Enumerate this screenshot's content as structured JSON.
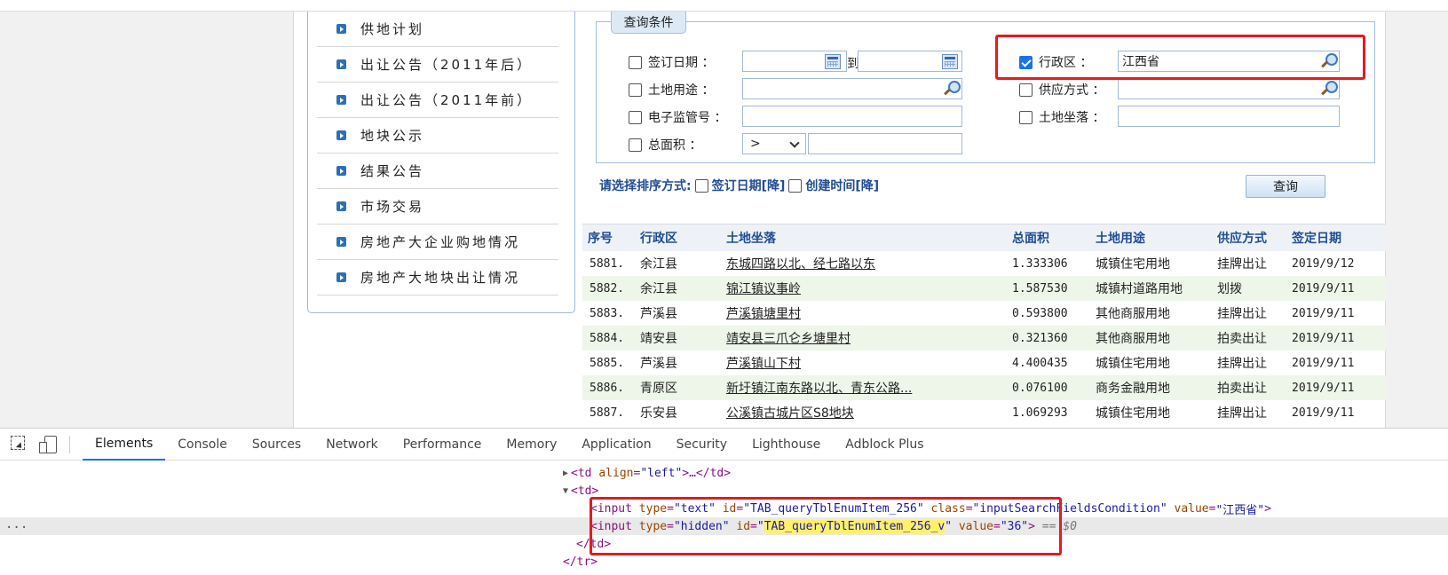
{
  "left_menu": {
    "items": [
      "供地计划",
      "出让公告（2011年后）",
      "出让公告（2011年前）",
      "地块公示",
      "结果公告",
      "市场交易",
      "房地产大企业购地情况",
      "房地产大地块出让情况"
    ]
  },
  "query": {
    "tab_label": "查询条件",
    "sign_date_label": "签订日期 ：",
    "to_label": "到",
    "region_label": "行政区 ：",
    "region_value": "江西省",
    "land_use_label": "土地用途 ：",
    "supply_label": "供应方式 ：",
    "supervision_label": "电子监管号 ：",
    "location_label": "土地坐落 ：",
    "area_label": "总面积 ：",
    "area_op": ">"
  },
  "sort": {
    "prompt": "请选择排序方式:",
    "option1": "签订日期[降]",
    "option2": "创建时间[降]"
  },
  "search_button": "查询",
  "table": {
    "headers": [
      "序号",
      "行政区",
      "土地坐落",
      "总面积",
      "土地用途",
      "供应方式",
      "签定日期"
    ],
    "rows": [
      [
        "5881.",
        "余江县",
        "东城四路以北、经七路以东",
        "1.333306",
        "城镇住宅用地",
        "挂牌出让",
        "2019/9/12"
      ],
      [
        "5882.",
        "余江县",
        "锦江镇议事岭",
        "1.587530",
        "城镇村道路用地",
        "划拨",
        "2019/9/11"
      ],
      [
        "5883.",
        "芦溪县",
        "芦溪镇塘里村",
        "0.593800",
        "其他商服用地",
        "挂牌出让",
        "2019/9/11"
      ],
      [
        "5884.",
        "靖安县",
        "靖安县三爪仑乡塘里村",
        "0.321360",
        "其他商服用地",
        "拍卖出让",
        "2019/9/11"
      ],
      [
        "5885.",
        "芦溪县",
        "芦溪镇山下村",
        "4.400435",
        "城镇住宅用地",
        "挂牌出让",
        "2019/9/11"
      ],
      [
        "5886.",
        "青原区",
        "新圩镇江南东路以北、青东公路...",
        "0.076100",
        "商务金融用地",
        "拍卖出让",
        "2019/9/11"
      ],
      [
        "5887.",
        "乐安县",
        "公溪镇古城片区S8地块",
        "1.069293",
        "城镇住宅用地",
        "挂牌出让",
        "2019/9/11"
      ]
    ]
  },
  "devtools": {
    "tabs": [
      "Elements",
      "Console",
      "Sources",
      "Network",
      "Performance",
      "Memory",
      "Application",
      "Security",
      "Lighthouse",
      "Adblock Plus"
    ],
    "active_tab": "Elements",
    "lines": {
      "l1_open": "<td ",
      "l1_attr": "align",
      "l1_val": "\"left\"",
      "l1_rest": ">…</td>",
      "l2": "<td>",
      "l3_tag": "<input ",
      "l3_type_attr": "type",
      "l3_type_val": "\"text\"",
      "l3_id_attr": "id",
      "l3_id_val": "\"TAB_queryTblEnumItem_256\"",
      "l3_class_attr": "class",
      "l3_class_val": "\"inputSearchFieldsCondition\"",
      "l3_value_attr": "value",
      "l3_value_val": "\"江西省\"",
      "l3_close": ">",
      "l4_tag": "<input ",
      "l4_type_attr": "type",
      "l4_type_val": "\"hidden\"",
      "l4_id_attr": "id",
      "l4_id_q": "\"",
      "l4_id_val": "TAB_queryTblEnumItem_256_v",
      "l4_value_attr": "value",
      "l4_value_val": "\"36\"",
      "l4_close": ">",
      "l4_eq": "== $0",
      "l5": "</td>",
      "l6": "</tr>",
      "ellipsis": "..."
    }
  },
  "colors": {
    "highlight_border": "#e8191f",
    "accent": "#1a73e8",
    "header_text": "#214d93"
  }
}
